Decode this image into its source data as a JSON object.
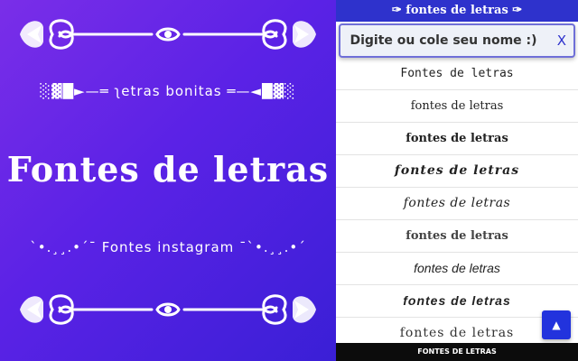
{
  "hero": {
    "subtitle_top": "ʅetras bonitas",
    "title": "Fontes de letras",
    "subtitle_bottom": "`•.¸¸.•´¯ Fontes instagram ¯`•.¸¸.•´"
  },
  "header": {
    "title": "✑ fontes de letras ✑"
  },
  "search": {
    "placeholder": "Digite ou cole seu nome :)",
    "clear_label": "X"
  },
  "list": {
    "items": [
      "Fontes de letras",
      "fontes de letras",
      "fontes de letras",
      "fontes de letras",
      "fontes de letras",
      "fontes de letras",
      "fontes de letras",
      "fontes de letras",
      "fontes de letras"
    ]
  },
  "scroll_top": {
    "icon": "arrow-up-icon",
    "glyph": "▲"
  },
  "footer": {
    "text": "FONTES DE LETRAS"
  },
  "colors": {
    "hero_start": "#7a2ee8",
    "hero_end": "#3a1fd6",
    "accent": "#2e32cc",
    "footer": "#0c0c0c"
  }
}
